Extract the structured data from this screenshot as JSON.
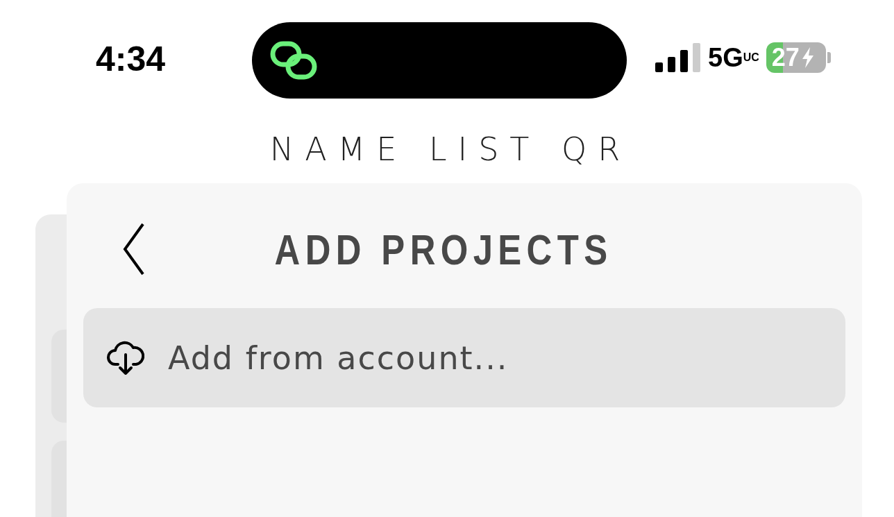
{
  "status_bar": {
    "time": "4:34",
    "network": "5G",
    "network_sub": "UC",
    "battery": "27"
  },
  "app_title": "NAME LIST QR",
  "panel": {
    "title": "ADD PROJECTS",
    "items": [
      {
        "label": "Add from account..."
      }
    ]
  }
}
